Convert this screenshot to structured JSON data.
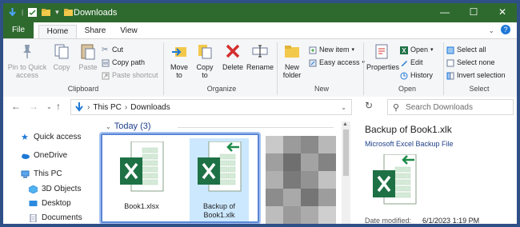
{
  "window": {
    "title": "Downloads",
    "minimize": "—",
    "maximize": "☐",
    "close": "✕"
  },
  "tabs": {
    "file": "File",
    "home": "Home",
    "share": "Share",
    "view": "View",
    "chevron": "⌄",
    "help": "?"
  },
  "ribbon": {
    "clipboard": {
      "pin": "Pin to Quick access",
      "copy": "Copy",
      "paste": "Paste",
      "cut": "Cut",
      "copy_path": "Copy path",
      "paste_shortcut": "Paste shortcut",
      "label": "Clipboard"
    },
    "organize": {
      "move_to": "Move to",
      "copy_to": "Copy to",
      "delete": "Delete",
      "rename": "Rename",
      "label": "Organize"
    },
    "new": {
      "new_folder": "New folder",
      "new_item": "New item",
      "easy_access": "Easy access",
      "label": "New"
    },
    "open": {
      "properties": "Properties",
      "open": "Open",
      "edit": "Edit",
      "history": "History",
      "label": "Open"
    },
    "select": {
      "select_all": "Select all",
      "select_none": "Select none",
      "invert": "Invert selection",
      "label": "Select"
    }
  },
  "address": {
    "this_pc": "This PC",
    "downloads": "Downloads",
    "search_placeholder": "Search Downloads"
  },
  "nav": {
    "quick_access": "Quick access",
    "onedrive": "OneDrive",
    "this_pc": "This PC",
    "objects3d": "3D Objects",
    "desktop": "Desktop",
    "documents": "Documents"
  },
  "content": {
    "group_header": "Today (3)",
    "files": [
      {
        "name": "Book1.xlsx"
      },
      {
        "name": "Backup of Book1.xlk"
      }
    ]
  },
  "preview": {
    "title": "Backup of Book1.xlk",
    "type": "Microsoft Excel Backup File",
    "modified_label": "Date modified:",
    "modified_value": "6/1/2023 1:19 PM"
  },
  "colors": {
    "excel_green": "#1e7145",
    "accent_blue": "#1e78d6",
    "title_bar": "#2e6a2e",
    "selection": "#cce8ff"
  }
}
